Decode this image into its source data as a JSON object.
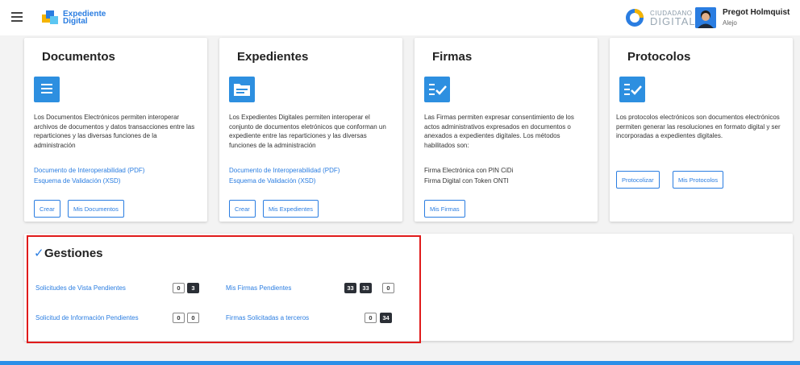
{
  "header": {
    "app_logo_line1": "Expediente",
    "app_logo_line2": "Digital",
    "brand_line1": "CIUDADANO",
    "brand_line2": "DIGITAL",
    "user_name": "Pregot Holmquist",
    "user_sub": "Alejo"
  },
  "cards": {
    "documentos": {
      "title": "Documentos",
      "description": "Los Documentos Electrónicos permiten interoperar archivos de documentos y datos transacciones entre las reparticiones y las diversas funciones de la administración",
      "link1": "Documento de Interoperabilidad (PDF)",
      "link2": "Esquema de Validación (XSD)",
      "btn1": "Crear",
      "btn2": "Mis Documentos"
    },
    "expedientes": {
      "title": "Expedientes",
      "description": "Los Expedientes Digitales permiten interoperar el conjunto de documentos eletrónicos que conforman un expediente entre las reparticiones y las diversas funciones de la administración",
      "link1": "Documento de Interoperabilidad (PDF)",
      "link2": "Esquema de Validación (XSD)",
      "btn1": "Crear",
      "btn2": "Mis Expedientes"
    },
    "firmas": {
      "title": "Firmas",
      "description": "Las Firmas permiten expresar consentimiento de los actos administrativos expresados en documentos o anexados a expedientes digitales. Los métodos habilitados son:",
      "method1": "Firma Electrónica con PIN CiDi",
      "method2": "Firma Digital con Token ONTI",
      "btn1": "Mis Firmas"
    },
    "protocolos": {
      "title": "Protocolos",
      "description": "Los protocolos electrónicos son documentos electrónicos permiten generar las resoluciones en formato digital y ser incorporadas a expedientes digitales.",
      "btn1": "Protocolizar",
      "btn2": "Mis Protocolos"
    }
  },
  "gestiones": {
    "title": "Gestiones",
    "items": [
      {
        "label": "Solicitudes de Vista Pendientes",
        "counts": [
          "0",
          "3"
        ]
      },
      {
        "label": "Solicitud de Información Pendientes",
        "counts": [
          "0",
          "0"
        ]
      },
      {
        "label": "Mis Firmas Pendientes",
        "counts": [
          "33",
          "33",
          "0"
        ]
      },
      {
        "label": "Firmas Solicitadas a terceros",
        "counts": [
          "0",
          "34"
        ]
      }
    ]
  },
  "colors": {
    "accent": "#2a7de1",
    "highlight": "#e01b1b",
    "dark_badge": "#2b2f36"
  }
}
